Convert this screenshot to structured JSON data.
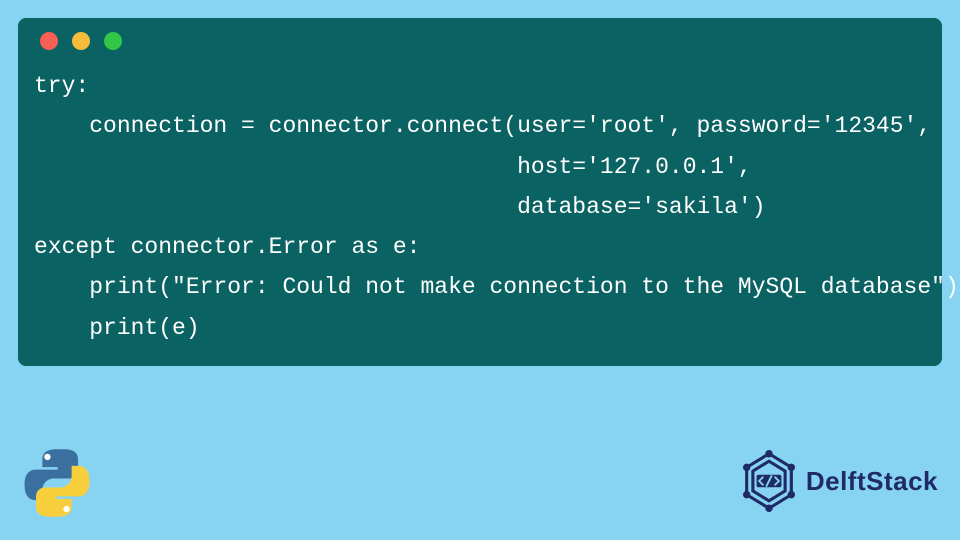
{
  "code": {
    "lines": [
      "try:",
      "    connection = connector.connect(user='root', password='12345',",
      "                                   host='127.0.0.1',",
      "                                   database='sakila')",
      "except connector.Error as e:",
      "    print(\"Error: Could not make connection to the MySQL database\")",
      "    print(e)"
    ]
  },
  "branding": {
    "name": "DelftStack"
  },
  "colors": {
    "page_bg": "#87d4f2",
    "code_bg": "#0a6262",
    "code_fg": "#ffffff",
    "brand_fg": "#1f2a66"
  }
}
